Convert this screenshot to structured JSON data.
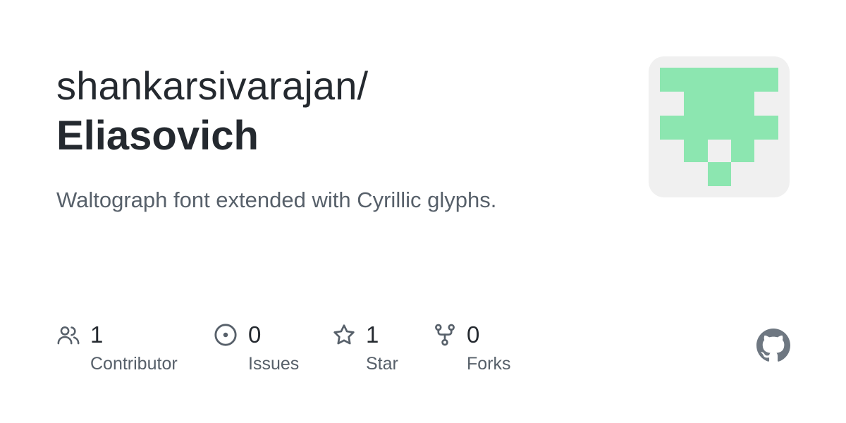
{
  "repo": {
    "owner": "shankarsivarajan/",
    "name": "Eliasovich",
    "description": "Waltograph font extended with Cyrillic glyphs."
  },
  "avatar": {
    "background_color": "#f0f0f0",
    "pixel_color": "#8ce6b0"
  },
  "stats": {
    "contributors": {
      "count": "1",
      "label": "Contributor",
      "icon": "people-icon"
    },
    "issues": {
      "count": "0",
      "label": "Issues",
      "icon": "issue-opened-icon"
    },
    "stars": {
      "count": "1",
      "label": "Star",
      "icon": "star-icon"
    },
    "forks": {
      "count": "0",
      "label": "Forks",
      "icon": "repo-forked-icon"
    }
  },
  "colors": {
    "text_primary": "#24292f",
    "text_secondary": "#57606a",
    "icon": "#57606a",
    "github_logo": "#6e7781"
  },
  "brand_icon": "github-mark-icon"
}
